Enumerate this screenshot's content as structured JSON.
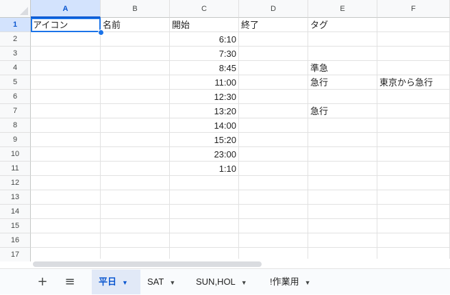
{
  "columns": [
    "A",
    "B",
    "C",
    "D",
    "E",
    "F"
  ],
  "rows": [
    {
      "num": "1",
      "cells": [
        "アイコン",
        "名前",
        "開始",
        "終了",
        "タグ",
        ""
      ]
    },
    {
      "num": "2",
      "cells": [
        "",
        "",
        "6:10",
        "",
        "",
        ""
      ]
    },
    {
      "num": "3",
      "cells": [
        "",
        "",
        "7:30",
        "",
        "",
        ""
      ]
    },
    {
      "num": "4",
      "cells": [
        "",
        "",
        "8:45",
        "",
        "準急",
        ""
      ]
    },
    {
      "num": "5",
      "cells": [
        "",
        "",
        "11:00",
        "",
        "急行",
        "東京から急行"
      ]
    },
    {
      "num": "6",
      "cells": [
        "",
        "",
        "12:30",
        "",
        "",
        ""
      ]
    },
    {
      "num": "7",
      "cells": [
        "",
        "",
        "13:20",
        "",
        "急行",
        ""
      ]
    },
    {
      "num": "8",
      "cells": [
        "",
        "",
        "14:00",
        "",
        "",
        ""
      ]
    },
    {
      "num": "9",
      "cells": [
        "",
        "",
        "15:20",
        "",
        "",
        ""
      ]
    },
    {
      "num": "10",
      "cells": [
        "",
        "",
        "23:00",
        "",
        "",
        ""
      ]
    },
    {
      "num": "11",
      "cells": [
        "",
        "",
        "1:10",
        "",
        "",
        ""
      ]
    },
    {
      "num": "12",
      "cells": [
        "",
        "",
        "",
        "",
        "",
        ""
      ]
    },
    {
      "num": "13",
      "cells": [
        "",
        "",
        "",
        "",
        "",
        ""
      ]
    },
    {
      "num": "14",
      "cells": [
        "",
        "",
        "",
        "",
        "",
        ""
      ]
    },
    {
      "num": "15",
      "cells": [
        "",
        "",
        "",
        "",
        "",
        ""
      ]
    },
    {
      "num": "16",
      "cells": [
        "",
        "",
        "",
        "",
        "",
        ""
      ]
    },
    {
      "num": "17",
      "cells": [
        "",
        "",
        "",
        "",
        "",
        ""
      ]
    }
  ],
  "selected_cell": "A1",
  "bottom_bar": {
    "add_sheet_icon": "plus-icon",
    "all_sheets_icon": "menu-icon",
    "tabs": [
      {
        "label": "平日",
        "active": true
      },
      {
        "label": "SAT",
        "active": false
      },
      {
        "label": "SUN,HOL",
        "active": false
      },
      {
        "label": "!作業用",
        "active": false
      }
    ]
  },
  "colors": {
    "accent": "#1a73e8",
    "active_tab_bg": "#e1e9f7",
    "header_bg": "#f8f9fa"
  }
}
